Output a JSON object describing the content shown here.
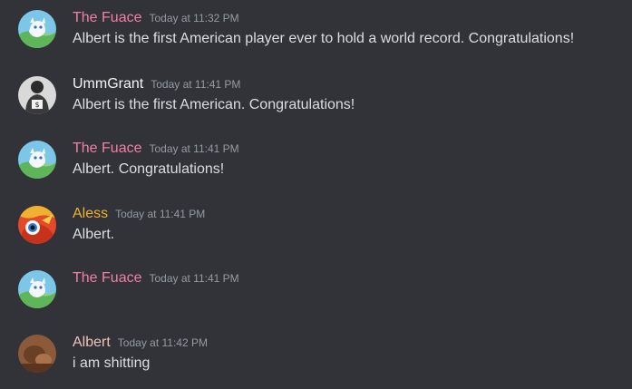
{
  "colors": {
    "background": "#313338",
    "message_text": "#dbdee1",
    "timestamp": "#949ba4",
    "the_fuace_name": "#f47fa6",
    "ummgrant_name": "#f2f3f5",
    "aless_name": "#f0b132",
    "albert_name": "#f1c1b6"
  },
  "messages": [
    {
      "author": "The Fuace",
      "timestamp": "Today at 11:32 PM",
      "content": "Albert is the first American player ever to hold a world record. Congratulations!",
      "avatar_icon": "snowy-landscape-avatar"
    },
    {
      "author": "UmmGrant",
      "timestamp": "Today at 11:41 PM",
      "content": "Albert is the first American. Congratulations!",
      "avatar_icon": "grayscale-person-avatar"
    },
    {
      "author": "The Fuace",
      "timestamp": "Today at 11:41 PM",
      "content": "Albert. Congratulations!",
      "avatar_icon": "snowy-landscape-avatar"
    },
    {
      "author": "Aless",
      "timestamp": "Today at 11:41 PM",
      "content": "Albert.",
      "avatar_icon": "red-fish-character-avatar"
    },
    {
      "author": "The Fuace",
      "timestamp": "Today at 11:41 PM",
      "content": "",
      "avatar_icon": "snowy-landscape-avatar"
    },
    {
      "author": "Albert",
      "timestamp": "Today at 11:42 PM",
      "content": "i am shitting",
      "avatar_icon": "brown-photo-avatar"
    }
  ]
}
